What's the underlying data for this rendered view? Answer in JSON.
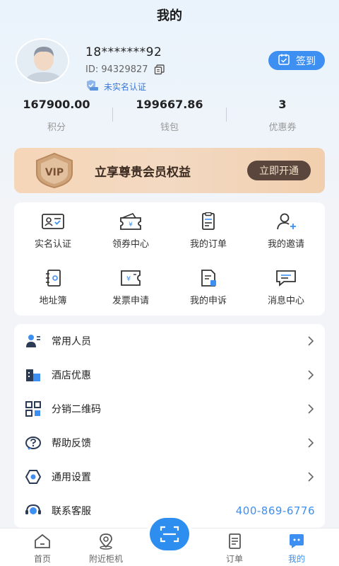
{
  "header": {
    "title": "我的"
  },
  "profile": {
    "phone": "18*******92",
    "id_text": "ID: 94329827",
    "auth_status": "未实名认证",
    "signin_label": "签到"
  },
  "stats": [
    {
      "value": "167900.00",
      "label": "积分"
    },
    {
      "value": "199667.86",
      "label": "钱包"
    },
    {
      "value": "3",
      "label": "优惠券"
    }
  ],
  "vip": {
    "badge": "VIP",
    "text": "立享尊贵会员权益",
    "button": "立即开通"
  },
  "grid": [
    {
      "label": "实名认证",
      "icon": "id-card-icon"
    },
    {
      "label": "领券中心",
      "icon": "coupon-icon"
    },
    {
      "label": "我的订单",
      "icon": "order-icon"
    },
    {
      "label": "我的邀请",
      "icon": "invite-icon"
    },
    {
      "label": "地址簿",
      "icon": "address-book-icon"
    },
    {
      "label": "发票申请",
      "icon": "invoice-icon"
    },
    {
      "label": "我的申诉",
      "icon": "appeal-icon"
    },
    {
      "label": "消息中心",
      "icon": "message-icon"
    }
  ],
  "list": [
    {
      "label": "常用人员",
      "icon": "people-icon"
    },
    {
      "label": "酒店优惠",
      "icon": "hotel-icon"
    },
    {
      "label": "分销二维码",
      "icon": "qrcode-icon"
    },
    {
      "label": "帮助反馈",
      "icon": "help-icon"
    },
    {
      "label": "通用设置",
      "icon": "settings-icon"
    },
    {
      "label": "联系客服",
      "icon": "service-icon",
      "value": "400-869-6776"
    }
  ],
  "tabbar": [
    {
      "label": "首页",
      "icon": "home-icon"
    },
    {
      "label": "附近柜机",
      "icon": "location-icon"
    },
    {
      "label": "订单",
      "icon": "order-tab-icon"
    },
    {
      "label": "我的",
      "icon": "mine-icon",
      "active": true
    }
  ],
  "colors": {
    "accent": "#3d8ff2",
    "vip_bg": "#f3d9c2",
    "vip_btn": "#5a463c"
  }
}
